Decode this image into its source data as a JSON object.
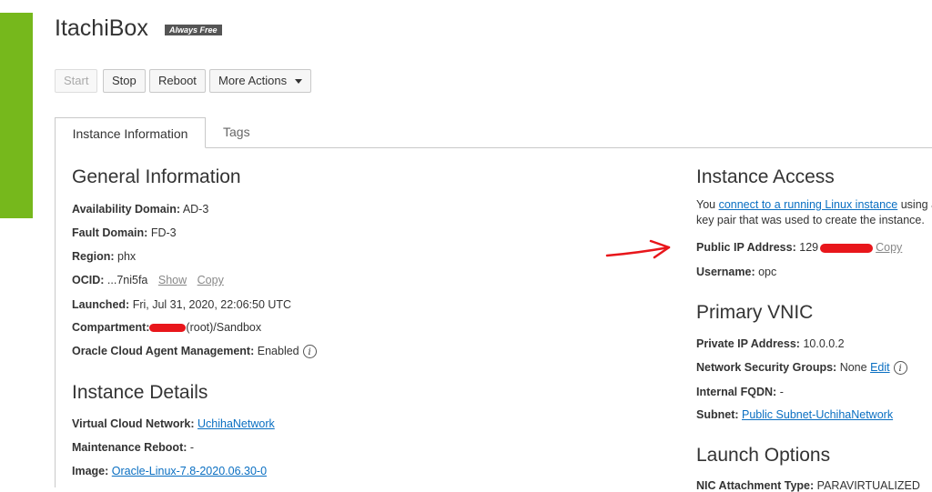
{
  "header": {
    "title": "ItachiBox",
    "badge": "Always Free"
  },
  "actions": {
    "start": "Start",
    "stop": "Stop",
    "reboot": "Reboot",
    "more": "More Actions"
  },
  "tabs": [
    {
      "label": "Instance Information"
    },
    {
      "label": "Tags"
    }
  ],
  "general": {
    "heading": "General Information",
    "availability_domain": {
      "label": "Availability Domain:",
      "value": "AD-3"
    },
    "fault_domain": {
      "label": "Fault Domain:",
      "value": "FD-3"
    },
    "region": {
      "label": "Region:",
      "value": "phx"
    },
    "ocid": {
      "label": "OCID:",
      "value": "...7ni5fa",
      "show": "Show",
      "copy": "Copy"
    },
    "launched": {
      "label": "Launched:",
      "value": "Fri, Jul 31, 2020, 22:06:50 UTC"
    },
    "compartment": {
      "label": "Compartment:",
      "value": "(root)/Sandbox"
    },
    "agent": {
      "label": "Oracle Cloud Agent Management:",
      "value": "Enabled"
    }
  },
  "details": {
    "heading": "Instance Details",
    "vcn": {
      "label": "Virtual Cloud Network:",
      "value": "UchihaNetwork"
    },
    "maintenance": {
      "label": "Maintenance Reboot:",
      "value": "-"
    },
    "image": {
      "label": "Image:",
      "value": "Oracle-Linux-7.8-2020.06.30-0"
    }
  },
  "access": {
    "heading": "Instance Access",
    "text_prefix": "You ",
    "text_link": "connect to a running Linux instance",
    "text_suffix": " using a",
    "text_line2": "key pair that was used to create the instance.",
    "public_ip": {
      "label": "Public IP Address:",
      "value": "129",
      "copy": "Copy"
    },
    "username": {
      "label": "Username:",
      "value": "opc"
    }
  },
  "vnic": {
    "heading": "Primary VNIC",
    "private_ip": {
      "label": "Private IP Address:",
      "value": "10.0.0.2"
    },
    "nsg": {
      "label": "Network Security Groups:",
      "value": "None",
      "edit": "Edit"
    },
    "fqdn": {
      "label": "Internal FQDN:",
      "value": "-"
    },
    "subnet": {
      "label": "Subnet:",
      "value": "Public Subnet-UchihaNetwork"
    }
  },
  "launch": {
    "heading": "Launch Options",
    "nic": {
      "label": "NIC Attachment Type:",
      "value": "PARAVIRTUALIZED"
    }
  },
  "colors": {
    "accent": "#76b81c",
    "link": "#0a6fc2",
    "redaction": "#e8161b"
  }
}
